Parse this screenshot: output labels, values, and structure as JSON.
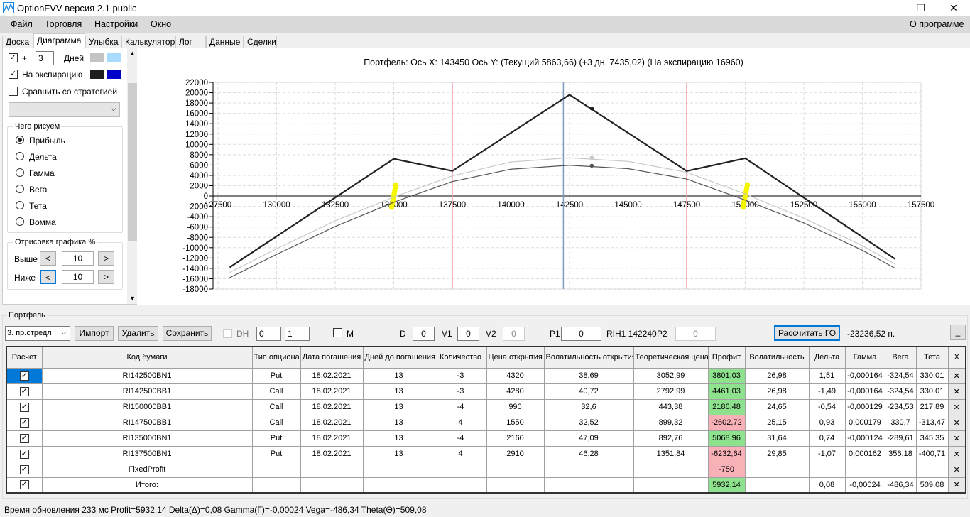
{
  "window": {
    "title": "OptionFVV версия 2.1 public",
    "minimize": "—",
    "maximize": "❐",
    "close": "✕"
  },
  "menu": {
    "items": [
      "Файл",
      "Торговля",
      "Настройки",
      "Окно"
    ],
    "about": "О программе"
  },
  "tabs": [
    "Доска",
    "Диаграмма",
    "Улыбка",
    "Калькулятор",
    "Лог",
    "Данные",
    "Сделки"
  ],
  "active_tab": "Диаграмма",
  "left": {
    "plus_label": "+",
    "days_value": "3",
    "days_label": "Дней",
    "days_checked": true,
    "expiration_label": "На экспирацию",
    "expiration_checked": true,
    "compare_label": "Сравнить со стратегией",
    "compare_checked": false,
    "colors": {
      "days_1": "#c3c3c3",
      "days_2": "#a9dbff",
      "exp_1": "#1e1e1e",
      "exp_2": "#0000c8"
    },
    "what_group": "Чего рисуем",
    "what_options": [
      "Прибыль",
      "Дельта",
      "Гамма",
      "Вега",
      "Тета",
      "Вомма"
    ],
    "what_selected": "Прибыль",
    "draw_group": "Отрисовка графика %",
    "above_label": "Выше",
    "above_value": "10",
    "below_label": "Ниже",
    "below_value": "10",
    "dec": "<",
    "inc": ">"
  },
  "chart_header": "Портфель: Ось X: 143450 Ось Y: (Текущий 5863,66) (+3 дн. 7435,02) (На экспирацию 16960)",
  "chart_data": {
    "type": "line",
    "xlim": [
      127500,
      157500
    ],
    "ylim": [
      -18000,
      22000
    ],
    "xticks": [
      127500,
      130000,
      132500,
      135000,
      137500,
      140000,
      142500,
      145000,
      147500,
      150000,
      152500,
      155000,
      157500
    ],
    "yticks": [
      22000,
      20000,
      18000,
      16000,
      14000,
      12000,
      10000,
      8000,
      6000,
      4000,
      2000,
      0,
      -2000,
      -4000,
      -6000,
      -8000,
      -10000,
      -12000,
      -14000,
      -16000,
      -18000
    ],
    "grid": true,
    "series": [
      {
        "color": "#222222",
        "x": [
          128000,
          135000,
          137500,
          142500,
          147500,
          150000,
          156400
        ],
        "y": [
          -13800,
          7200,
          4850,
          19600,
          4850,
          7300,
          -12200
        ]
      },
      {
        "color": "#c8c8c8",
        "x": [
          128000,
          130000,
          132500,
          135000,
          137500,
          140000,
          142500,
          145000,
          147500,
          150000,
          152500,
          155000,
          156400
        ],
        "y": [
          -14800,
          -10200,
          -4800,
          -200,
          3900,
          6600,
          7400,
          6700,
          4600,
          400,
          -4300,
          -9600,
          -13200
        ]
      },
      {
        "color": "#555555",
        "x": [
          128000,
          130000,
          132500,
          135000,
          137500,
          140000,
          142500,
          145000,
          147500,
          150000,
          152500,
          155000,
          156400
        ],
        "y": [
          -15800,
          -11300,
          -5900,
          -1200,
          2800,
          5200,
          5950,
          5300,
          3300,
          -800,
          -5200,
          -10500,
          -14000
        ]
      }
    ],
    "markers": [
      {
        "x": 143450,
        "y": 16960,
        "color": "#222222"
      },
      {
        "x": 143450,
        "y": 5863.66,
        "color": "#555555"
      },
      {
        "x": 143450,
        "y": 7435.02,
        "color": "#c8c8c8"
      }
    ],
    "vlines": [
      {
        "x": 137500,
        "color": "#f4a0a8"
      },
      {
        "x": 142240,
        "color": "#7f9cc0"
      },
      {
        "x": 147500,
        "color": "#f4a0a8"
      }
    ],
    "highlights": [
      135000,
      150000
    ],
    "highlight_color": "#f5f500"
  },
  "portfolio": {
    "label": "Портфель",
    "strategy": "3. пр.стредл",
    "import": "Импорт",
    "delete": "Удалить",
    "save": "Сохранить",
    "dh_label": "DH",
    "spin1": "0",
    "spin2": "1",
    "m_label": "M",
    "d_label": "D",
    "d_value": "0",
    "v1_label": "V1",
    "v1_value": "0",
    "v2_label": "V2",
    "v2_value": "0",
    "p1_label": "P1",
    "p1_value": "0",
    "underlying": "RIH1 142240",
    "p2_label": "P2",
    "p2_value": "0",
    "calc_go": "Рассчитать ГО",
    "go_value": "-23236,52 п.",
    "min_btn": "_"
  },
  "table": {
    "headers": [
      "Расчет",
      "Код бумаги",
      "Тип опциона",
      "Дата погашения",
      "Дней до погашения",
      "Количество",
      "Цена открытия",
      "Волатильность открытия",
      "Теоретическая цена",
      "Профит",
      "Волатильность",
      "Дельта",
      "Гамма",
      "Вега",
      "Тета",
      "X"
    ],
    "rows": [
      [
        "RI142500BN1",
        "Put",
        "18.02.2021",
        "13",
        "-3",
        "4320",
        "38,69",
        "3052,99",
        "3801,03",
        "26,98",
        "1,51",
        "-0,000164",
        "-324,54",
        "330,01"
      ],
      [
        "RI142500BB1",
        "Call",
        "18.02.2021",
        "13",
        "-3",
        "4280",
        "40,72",
        "2792,99",
        "4461,03",
        "26,98",
        "-1,49",
        "-0,000164",
        "-324,54",
        "330,01"
      ],
      [
        "RI150000BB1",
        "Call",
        "18.02.2021",
        "13",
        "-4",
        "990",
        "32,6",
        "443,38",
        "2186,48",
        "24,65",
        "-0,54",
        "-0,000129",
        "-234,53",
        "217,89"
      ],
      [
        "RI147500BB1",
        "Call",
        "18.02.2021",
        "13",
        "4",
        "1550",
        "32,52",
        "899,32",
        "-2602,72",
        "25,15",
        "0,93",
        "0,000179",
        "330,7",
        "-313,47"
      ],
      [
        "RI135000BN1",
        "Put",
        "18.02.2021",
        "13",
        "-4",
        "2160",
        "47,09",
        "892,76",
        "5068,96",
        "31,64",
        "0,74",
        "-0,000124",
        "-289,61",
        "345,35"
      ],
      [
        "RI137500BN1",
        "Put",
        "18.02.2021",
        "13",
        "4",
        "2910",
        "46,28",
        "1351,84",
        "-6232,64",
        "29,85",
        "-1,07",
        "0,000162",
        "356,18",
        "-400,71"
      ],
      [
        "FixedProfit",
        "",
        "",
        "",
        "",
        "",
        "",
        "",
        "-750",
        "",
        "",
        "",
        "",
        ""
      ],
      [
        "Итого:",
        "",
        "",
        "",
        "",
        "",
        "",
        "",
        "5932,14",
        "",
        "0,08",
        "-0,00024",
        "-486,34",
        "509,08"
      ]
    ],
    "profit_status": [
      "pos",
      "pos",
      "pos",
      "neg",
      "pos",
      "neg",
      "neg",
      "pos"
    ],
    "delete_icon": "✕"
  },
  "status": "Время обновления 233 мс  Profit=5932,14 Delta(Δ)=0,08 Gamma(Γ)=-0,00024 Vega=-486,34 Theta(Θ)=509,08"
}
